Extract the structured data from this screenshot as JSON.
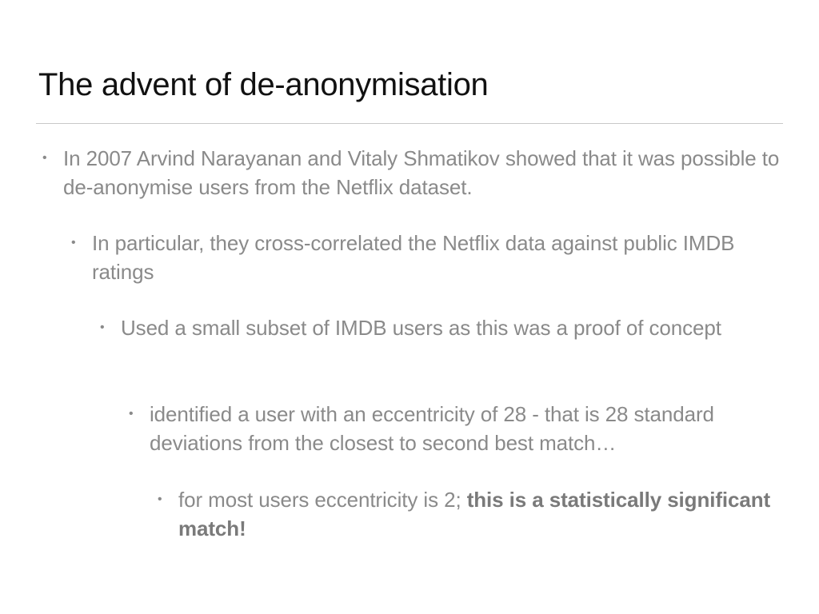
{
  "slide": {
    "title": "The advent of de-anonymisation",
    "bullet_symbol": "•",
    "bullets": [
      {
        "text": "In 2007 Arvind Narayanan and Vitaly Shmatikov showed that it was possible to de-anonymise users from the Netflix dataset."
      },
      {
        "text": "In particular, they cross-correlated the Netflix data against public IMDB ratings"
      },
      {
        "text": "Used a small subset of IMDB users as this was a proof of concept"
      },
      {
        "text": "identified a user with an eccentricity of 28 - that is 28 standard deviations from the closest to second best match…"
      },
      {
        "text": "for most users eccentricity is 2; ",
        "emphasis": "this is a statistically significant match!"
      }
    ]
  },
  "colors": {
    "title": "#111111",
    "body_text": "#8a8a8a",
    "emphasis_text": "#7a7a7a",
    "rule": "#c8c8c8",
    "background": "#ffffff"
  }
}
